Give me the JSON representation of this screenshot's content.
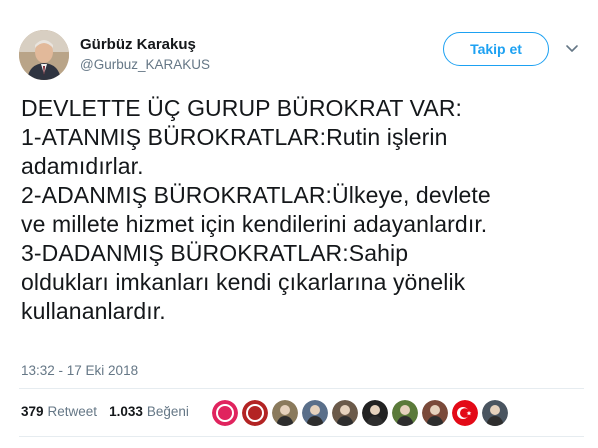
{
  "tweet": {
    "author_name": "Gürbüz Karakuş",
    "author_handle": "@Gurbuz_KARAKUS",
    "follow_label": "Takip et",
    "text_lines": [
      "DEVLETTE ÜÇ GURUP BÜROKRAT VAR:",
      "1-ATANMIŞ BÜROKRATLAR:Rutin işlerin",
      "adamıdırlar.",
      "2-ADANMIŞ BÜROKRATLAR:Ülkeye, devlete",
      "ve millete hizmet için kendilerini adayanlardır.",
      "3-DADANMIŞ BÜROKRATLAR:Sahip",
      "oldukları imkanları kendi çıkarlarına yönelik",
      "kullananlardır."
    ],
    "timestamp": "13:32 - 17 Eki 2018"
  },
  "stats": {
    "retweet_count": "379",
    "retweet_label": "Retweet",
    "like_count": "1.033",
    "like_label": "Beğeni"
  },
  "likers": [
    {
      "name": "liker-avatar-1",
      "color": "#e0245e"
    },
    {
      "name": "liker-avatar-2",
      "color": "#b32424"
    },
    {
      "name": "liker-avatar-3",
      "color": "#8a7a5c"
    },
    {
      "name": "liker-avatar-4",
      "color": "#5a6f8a"
    },
    {
      "name": "liker-avatar-5",
      "color": "#6b5a4a"
    },
    {
      "name": "liker-avatar-6",
      "color": "#222222"
    },
    {
      "name": "liker-avatar-7",
      "color": "#5b7a3a"
    },
    {
      "name": "liker-avatar-8",
      "color": "#7a4a3a"
    },
    {
      "name": "liker-avatar-9",
      "color": "#e30a17"
    },
    {
      "name": "liker-avatar-10",
      "color": "#4a5560"
    }
  ],
  "colors": {
    "accent": "#1da1f2",
    "secondary_text": "#657786",
    "divider": "#e6ecf0"
  },
  "icons": {
    "caret": "chevron-down-icon"
  }
}
